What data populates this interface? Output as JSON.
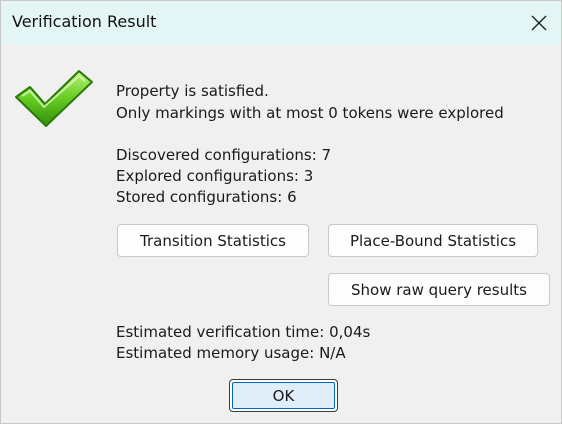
{
  "window": {
    "title": "Verification Result"
  },
  "result": {
    "icon": "checkmark-icon",
    "accent_color": "#4caf1a",
    "line1": "Property is satisfied.",
    "line2": "Only markings with at most 0 tokens were explored"
  },
  "stats": {
    "discovered": "Discovered configurations: 7",
    "explored": "Explored configurations: 3",
    "stored": "Stored configurations: 6"
  },
  "buttons": {
    "transition_statistics": "Transition Statistics",
    "place_bound_statistics": "Place-Bound Statistics",
    "show_raw_query_results": "Show raw query results",
    "ok": "OK"
  },
  "estimates": {
    "time": "Estimated verification time: 0,04s",
    "memory": "Estimated memory usage: N/A"
  }
}
